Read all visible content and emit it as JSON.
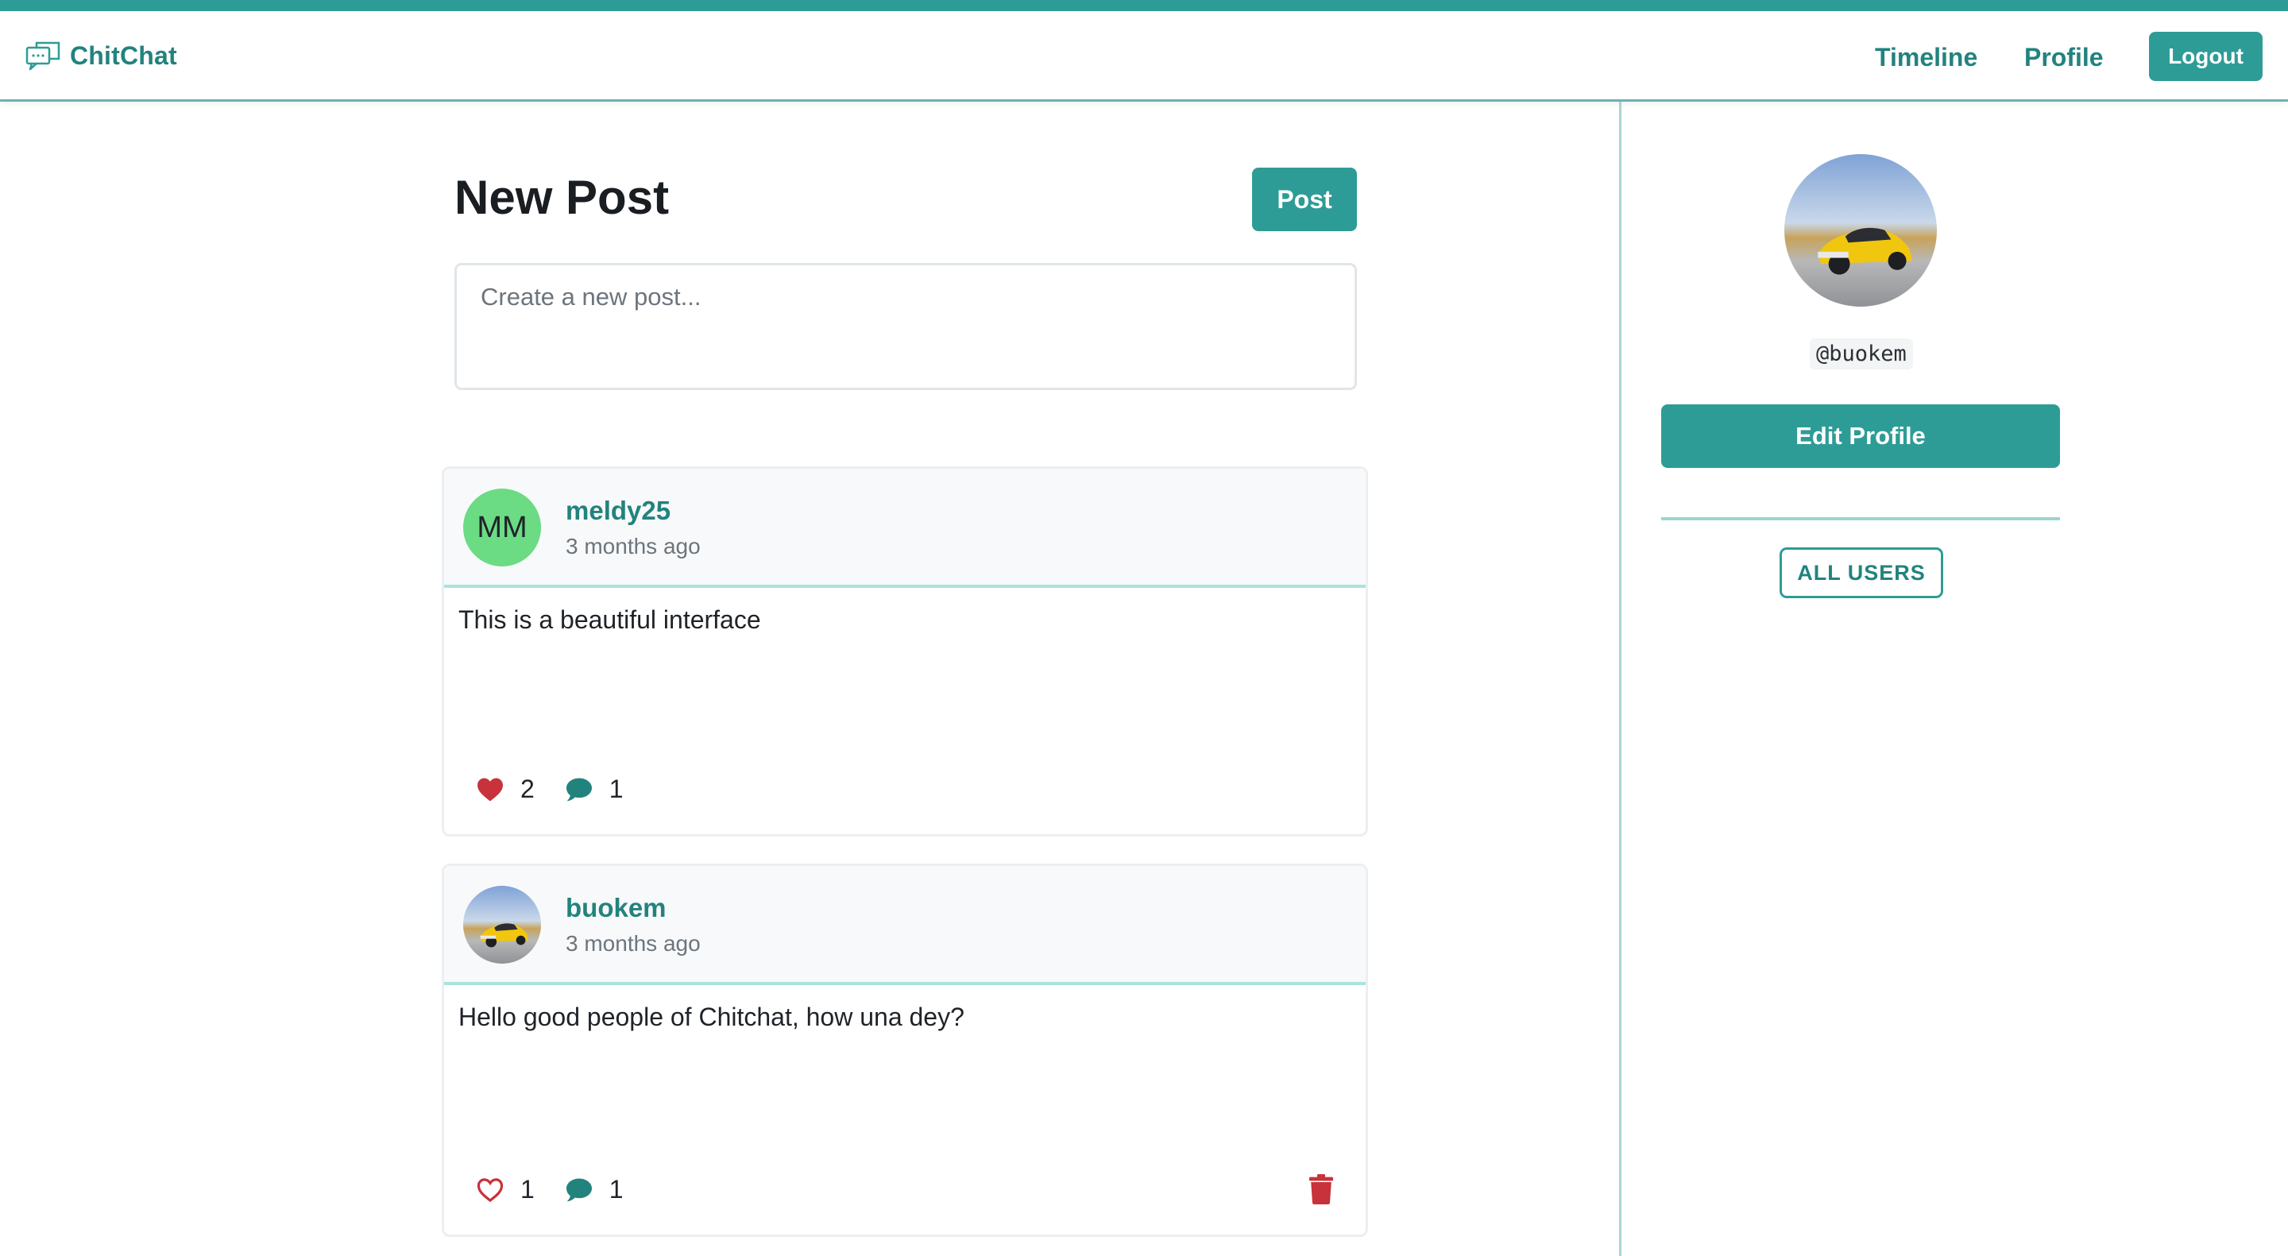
{
  "navbar": {
    "brand_name": "ChitChat",
    "links": {
      "timeline": "Timeline",
      "profile": "Profile"
    },
    "logout_label": "Logout"
  },
  "new_post": {
    "title": "New Post",
    "post_button": "Post",
    "placeholder": "Create a new post..."
  },
  "posts": [
    {
      "author": "meldy25",
      "initials": "MM",
      "time": "3 months ago",
      "body": "This is a beautiful interface",
      "likes": "2",
      "liked": true,
      "comments": "1",
      "can_delete": false
    },
    {
      "author": "buokem",
      "initials": "",
      "time": "3 months ago",
      "body": "Hello good people of Chitchat, how una dey?",
      "likes": "1",
      "liked": false,
      "comments": "1",
      "can_delete": true
    }
  ],
  "sidebar": {
    "username": "@buokem",
    "edit_profile_label": "Edit Profile",
    "all_users_label": "ALL USERS"
  },
  "colors": {
    "accent": "#2e9c96",
    "accent_text": "#22837e",
    "like_red": "#c8323a",
    "initials_avatar": "#6bdb84"
  },
  "icons": {
    "brand": "chat-bubbles-icon",
    "like_filled": "heart-filled-icon",
    "like_outline": "heart-outline-icon",
    "comment": "comment-bubble-icon",
    "delete": "trash-icon"
  }
}
